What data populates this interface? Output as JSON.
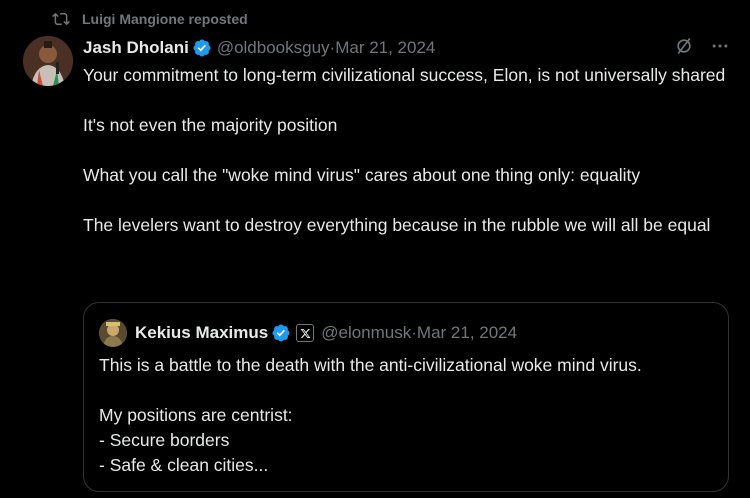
{
  "repost": {
    "icon": "repost-icon",
    "label": "Luigi Mangione reposted"
  },
  "tweet": {
    "author_name": "Jash Dholani",
    "handle": "@oldbooksguy",
    "separator": " · ",
    "date": "Mar 21, 2024",
    "lines": [
      "Your commitment to long-term civilizational success, Elon, is not universally shared",
      "It's not even the majority position",
      "What you call the \"woke mind virus\" cares about one thing only: equality",
      "The levelers want to destroy everything because in the rubble we will all be equal"
    ]
  },
  "quote": {
    "author_name": "Kekius Maximus",
    "handle": "@elonmusk",
    "separator": " · ",
    "date": "Mar 21, 2024",
    "line1": "This is a battle to the death with the anti-civilizational woke mind virus.",
    "line2": "My positions are centrist:",
    "line3": "- Secure borders",
    "line4": "- Safe & clean cities..."
  },
  "colors": {
    "background": "#000000",
    "text": "#e7e9ea",
    "muted": "#71767b",
    "verified": "#1d9bf0",
    "border": "#2f3336"
  }
}
